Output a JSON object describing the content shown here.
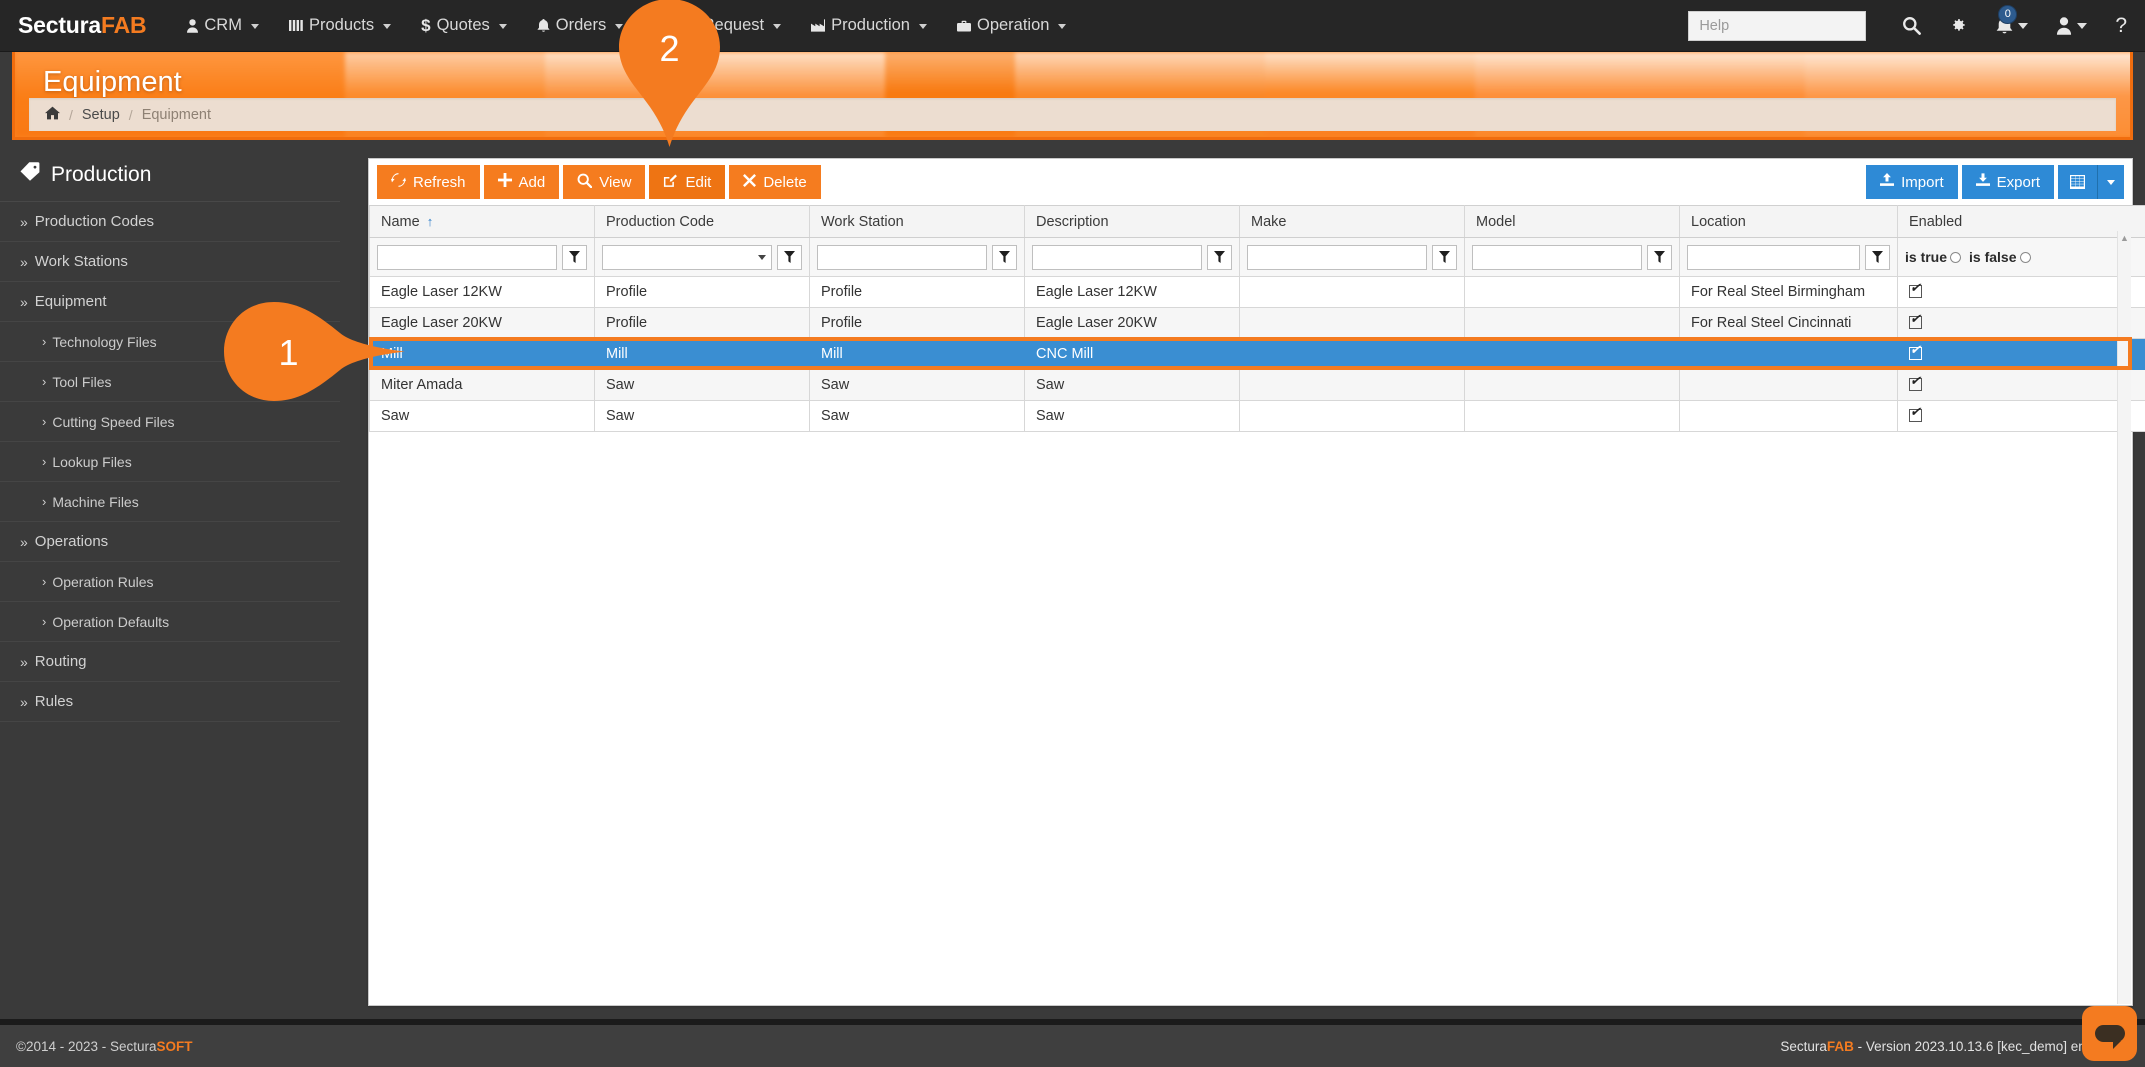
{
  "navbar": {
    "brand_main": "Sectura",
    "brand_accent": "FAB",
    "items": [
      {
        "label": "CRM",
        "icon": "user-icon"
      },
      {
        "label": "Products",
        "icon": "bars-icon"
      },
      {
        "label": "Quotes",
        "icon": "dollar-icon"
      },
      {
        "label": "Orders",
        "icon": "bell-icon"
      },
      {
        "label": "Bid Request",
        "icon": "hammer-icon"
      },
      {
        "label": "Production",
        "icon": "production-icon"
      },
      {
        "label": "Operation",
        "icon": "briefcase-icon"
      }
    ],
    "help_placeholder": "Help",
    "search_icon": "search-icon",
    "settings_icon": "gear-icon",
    "notifications_icon": "bell-icon",
    "notifications_count": "0",
    "user_icon": "user-icon",
    "help_icon": "question-mark-icon"
  },
  "header": {
    "title": "Equipment",
    "breadcrumb": {
      "home_icon": "home-icon",
      "separator": "/",
      "items": [
        "Setup",
        "Equipment"
      ]
    }
  },
  "sidebar": {
    "title": "Production",
    "title_icon": "tag-icon",
    "items": [
      {
        "label": "Production Codes",
        "level": 1
      },
      {
        "label": "Work Stations",
        "level": 1
      },
      {
        "label": "Equipment",
        "level": 1
      },
      {
        "label": "Technology Files",
        "level": 2
      },
      {
        "label": "Tool Files",
        "level": 2
      },
      {
        "label": "Cutting Speed Files",
        "level": 2
      },
      {
        "label": "Lookup Files",
        "level": 2
      },
      {
        "label": "Machine Files",
        "level": 2
      },
      {
        "label": "Operations",
        "level": 1
      },
      {
        "label": "Operation Rules",
        "level": 2
      },
      {
        "label": "Operation Defaults",
        "level": 2
      },
      {
        "label": "Routing",
        "level": 1
      },
      {
        "label": "Rules",
        "level": 1
      }
    ]
  },
  "toolbar": {
    "refresh_label": "Refresh",
    "add_label": "Add",
    "view_label": "View",
    "edit_label": "Edit",
    "delete_label": "Delete",
    "import_label": "Import",
    "export_label": "Export",
    "grid_icon": "table-icon",
    "grid_caret_icon": "chevron-down-icon"
  },
  "grid": {
    "columns": [
      {
        "label": "Name",
        "sorted": "asc",
        "filter": "text"
      },
      {
        "label": "Production Code",
        "filter": "select"
      },
      {
        "label": "Work Station",
        "filter": "text"
      },
      {
        "label": "Description",
        "filter": "text"
      },
      {
        "label": "Make",
        "filter": "text"
      },
      {
        "label": "Model",
        "filter": "text"
      },
      {
        "label": "Location",
        "filter": "text"
      },
      {
        "label": "Enabled",
        "filter": "radio"
      }
    ],
    "sort_icon": "arrow-up-icon",
    "filter_icon": "funnel-icon",
    "enabled_filter": {
      "true_label": "is true",
      "false_label": "is false"
    },
    "rows": [
      {
        "name": "Eagle Laser 12KW",
        "production_code": "Profile",
        "work_station": "Profile",
        "description": "Eagle Laser 12KW",
        "make": "",
        "model": "",
        "location": "For Real Steel Birmingham",
        "enabled": true,
        "selected": false
      },
      {
        "name": "Eagle Laser 20KW",
        "production_code": "Profile",
        "work_station": "Profile",
        "description": "Eagle Laser 20KW",
        "make": "",
        "model": "",
        "location": "For Real Steel Cincinnati",
        "enabled": true,
        "selected": false
      },
      {
        "name": "Mill",
        "production_code": "Mill",
        "work_station": "Mill",
        "description": "CNC Mill",
        "make": "",
        "model": "",
        "location": "",
        "enabled": true,
        "selected": true
      },
      {
        "name": "Miter Amada",
        "production_code": "Saw",
        "work_station": "Saw",
        "description": "Saw",
        "make": "",
        "model": "",
        "location": "",
        "enabled": true,
        "selected": false
      },
      {
        "name": "Saw",
        "production_code": "Saw",
        "work_station": "Saw",
        "description": "Saw",
        "make": "",
        "model": "",
        "location": "",
        "enabled": true,
        "selected": false
      }
    ]
  },
  "callouts": [
    {
      "number": "1",
      "direction": "right"
    },
    {
      "number": "2",
      "direction": "down"
    }
  ],
  "footer": {
    "copyright_main": "©2014 - 2023 - Sectura",
    "copyright_accent": "SOFT",
    "version_brand_main": "Sectura",
    "version_brand_accent": "FAB",
    "version_text": " - Version 2023.10.13.6 [kec_demo] en-US",
    "chat_icon": "chat-bubble-icon"
  },
  "colors": {
    "accent_orange": "#f47b20",
    "nav_dark": "#262626",
    "selection_blue": "#3a8ed2",
    "button_blue": "#2e8ad6"
  }
}
